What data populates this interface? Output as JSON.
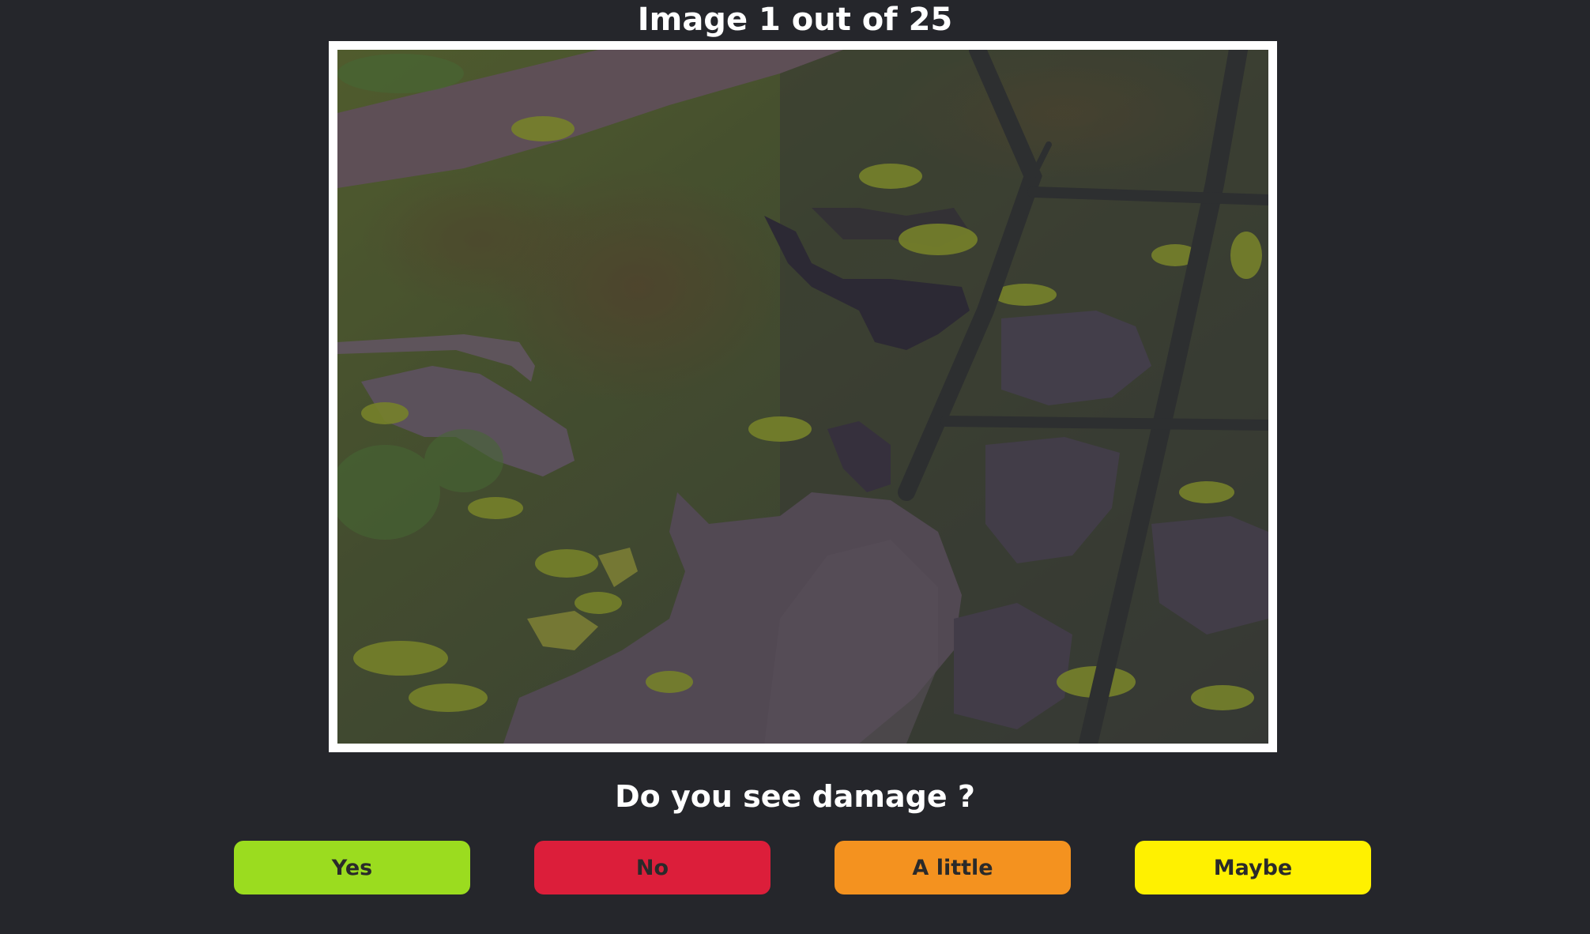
{
  "header": {
    "title": "Image 1 out of 25"
  },
  "image_panel": {
    "content": "aerial-marsh-photo"
  },
  "question": {
    "text": "Do you see damage ?"
  },
  "answers": [
    {
      "label": "Yes",
      "color": "#9bdc1f"
    },
    {
      "label": "No",
      "color": "#dc1e3a"
    },
    {
      "label": "A little",
      "color": "#f4921f"
    },
    {
      "label": "Maybe",
      "color": "#fff100"
    }
  ],
  "colors": {
    "background": "#25262b",
    "frame": "#ffffff",
    "text": "#ffffff"
  }
}
